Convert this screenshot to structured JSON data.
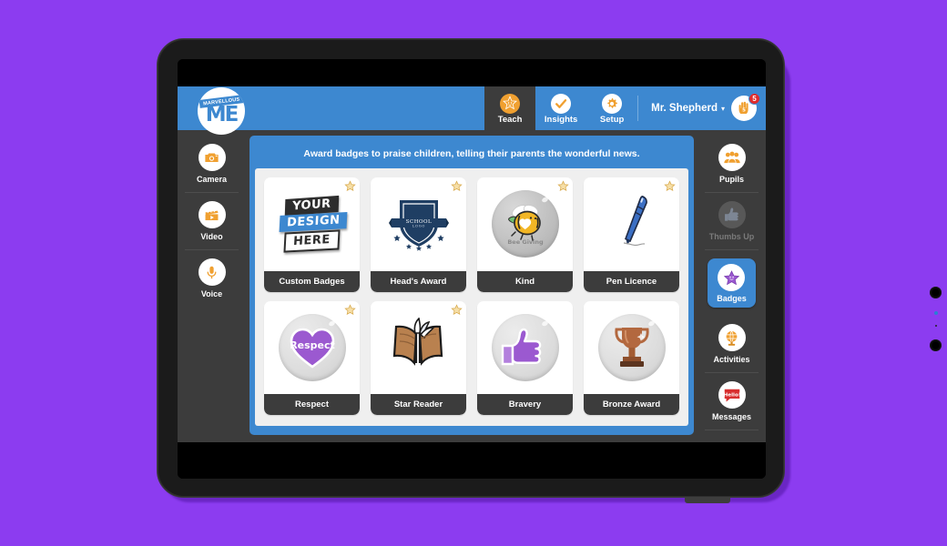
{
  "app": {
    "logo_tagline": "MARVELLOUS",
    "logo_text": "ME"
  },
  "topnav": {
    "tabs": [
      {
        "label": "Teach",
        "icon": "orange-star-face-icon",
        "active": true
      },
      {
        "label": "Insights",
        "icon": "check-circle-icon",
        "active": false
      },
      {
        "label": "Setup",
        "icon": "gear-icon",
        "active": false
      }
    ],
    "user_name": "Mr. Shepherd",
    "caret": "▾",
    "avatar_icon": "high-five-hand-icon",
    "notification_count": "5"
  },
  "left_sidebar": {
    "items": [
      {
        "label": "Camera",
        "icon": "camera-icon"
      },
      {
        "label": "Video",
        "icon": "clapperboard-play-icon"
      },
      {
        "label": "Voice",
        "icon": "microphone-icon"
      }
    ]
  },
  "right_sidebar": {
    "items": [
      {
        "label": "Pupils",
        "icon": "pupils-group-icon",
        "state": "normal"
      },
      {
        "label": "Thumbs Up",
        "icon": "thumbs-up-icon",
        "state": "disabled"
      },
      {
        "label": "Badges",
        "icon": "purple-star-icon",
        "state": "active"
      },
      {
        "label": "Activities",
        "icon": "activities-globe-icon",
        "state": "normal"
      },
      {
        "label": "Messages",
        "icon": "speech-bubble-hello-icon",
        "state": "normal"
      }
    ]
  },
  "main": {
    "title": "Award badges to praise children, telling their parents the wonderful news.",
    "badges": [
      {
        "label": "Custom Badges",
        "art": "your-design-here",
        "starred": true
      },
      {
        "label": "Head's Award",
        "art": "shield",
        "starred": true,
        "shield_text": "SCHOOL LOGO"
      },
      {
        "label": "Kind",
        "art": "bee",
        "starred": true,
        "bee_text": "Bee Giving"
      },
      {
        "label": "Pen Licence",
        "art": "pen",
        "starred": true
      },
      {
        "label": "Respect",
        "art": "heart",
        "starred": true,
        "heart_text": "Respect"
      },
      {
        "label": "Star Reader",
        "art": "book",
        "starred": true
      },
      {
        "label": "Bravery",
        "art": "thumb",
        "starred": false
      },
      {
        "label": "Bronze Award",
        "art": "trophy",
        "starred": false
      }
    ]
  },
  "colors": {
    "background": "#8c3cf0",
    "brand_blue": "#3d88d0",
    "chrome_dark": "#3c3c3c",
    "accent_orange": "#f0a030",
    "alert_red": "#e02b2b",
    "badge_purple": "#9b59d0"
  }
}
